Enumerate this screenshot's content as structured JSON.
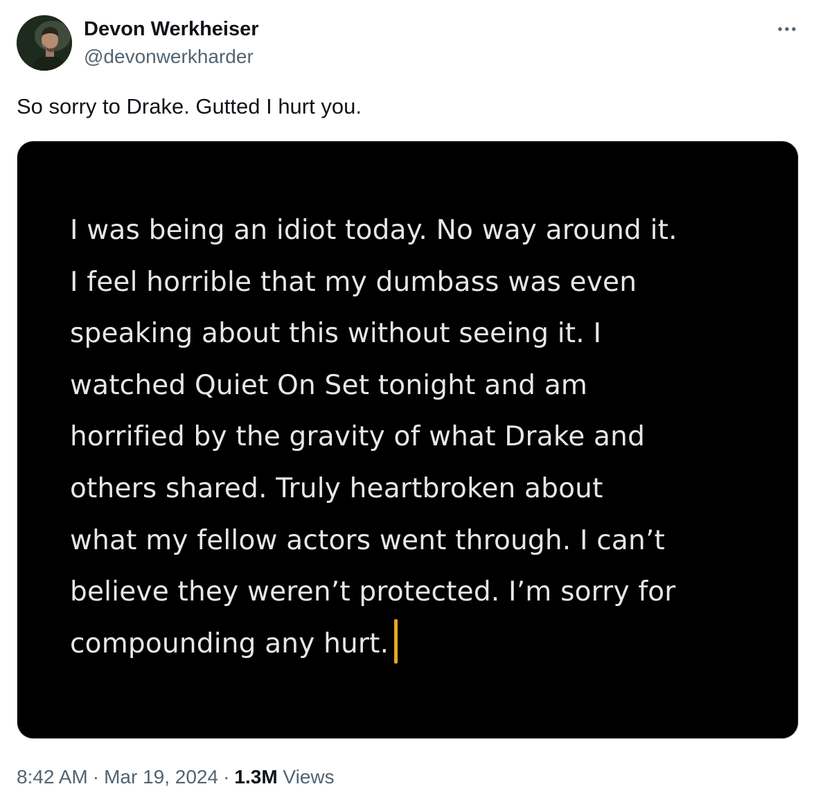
{
  "author": {
    "display_name": "Devon Werkheiser",
    "handle": "@devonwerkharder"
  },
  "tweet": {
    "text": "So sorry to Drake. Gutted I hurt you.",
    "image_text_lines": [
      "I was being an idiot today. No way around it.",
      "I feel horrible that my dumbass was even",
      "speaking about this without seeing it. I",
      "watched Quiet On Set tonight and am",
      "horrified by the gravity of what Drake and",
      "others shared. Truly heartbroken about",
      "what my fellow actors went through. I can’t",
      "believe they weren’t protected. I’m sorry for",
      "compounding any hurt."
    ],
    "image_background_color": "#000000",
    "image_text_color": "#e7e7e7",
    "caret_color": "#e8a826"
  },
  "meta": {
    "time": "8:42 AM",
    "separator": "·",
    "date": "Mar 19, 2024",
    "views_count": "1.3M",
    "views_label": "Views"
  },
  "icons": {
    "more": "more-horizontal-icon",
    "avatar": "profile-photo"
  },
  "colors": {
    "primary_text": "#0f1419",
    "secondary_text": "#536471",
    "border": "#cfd9de"
  }
}
